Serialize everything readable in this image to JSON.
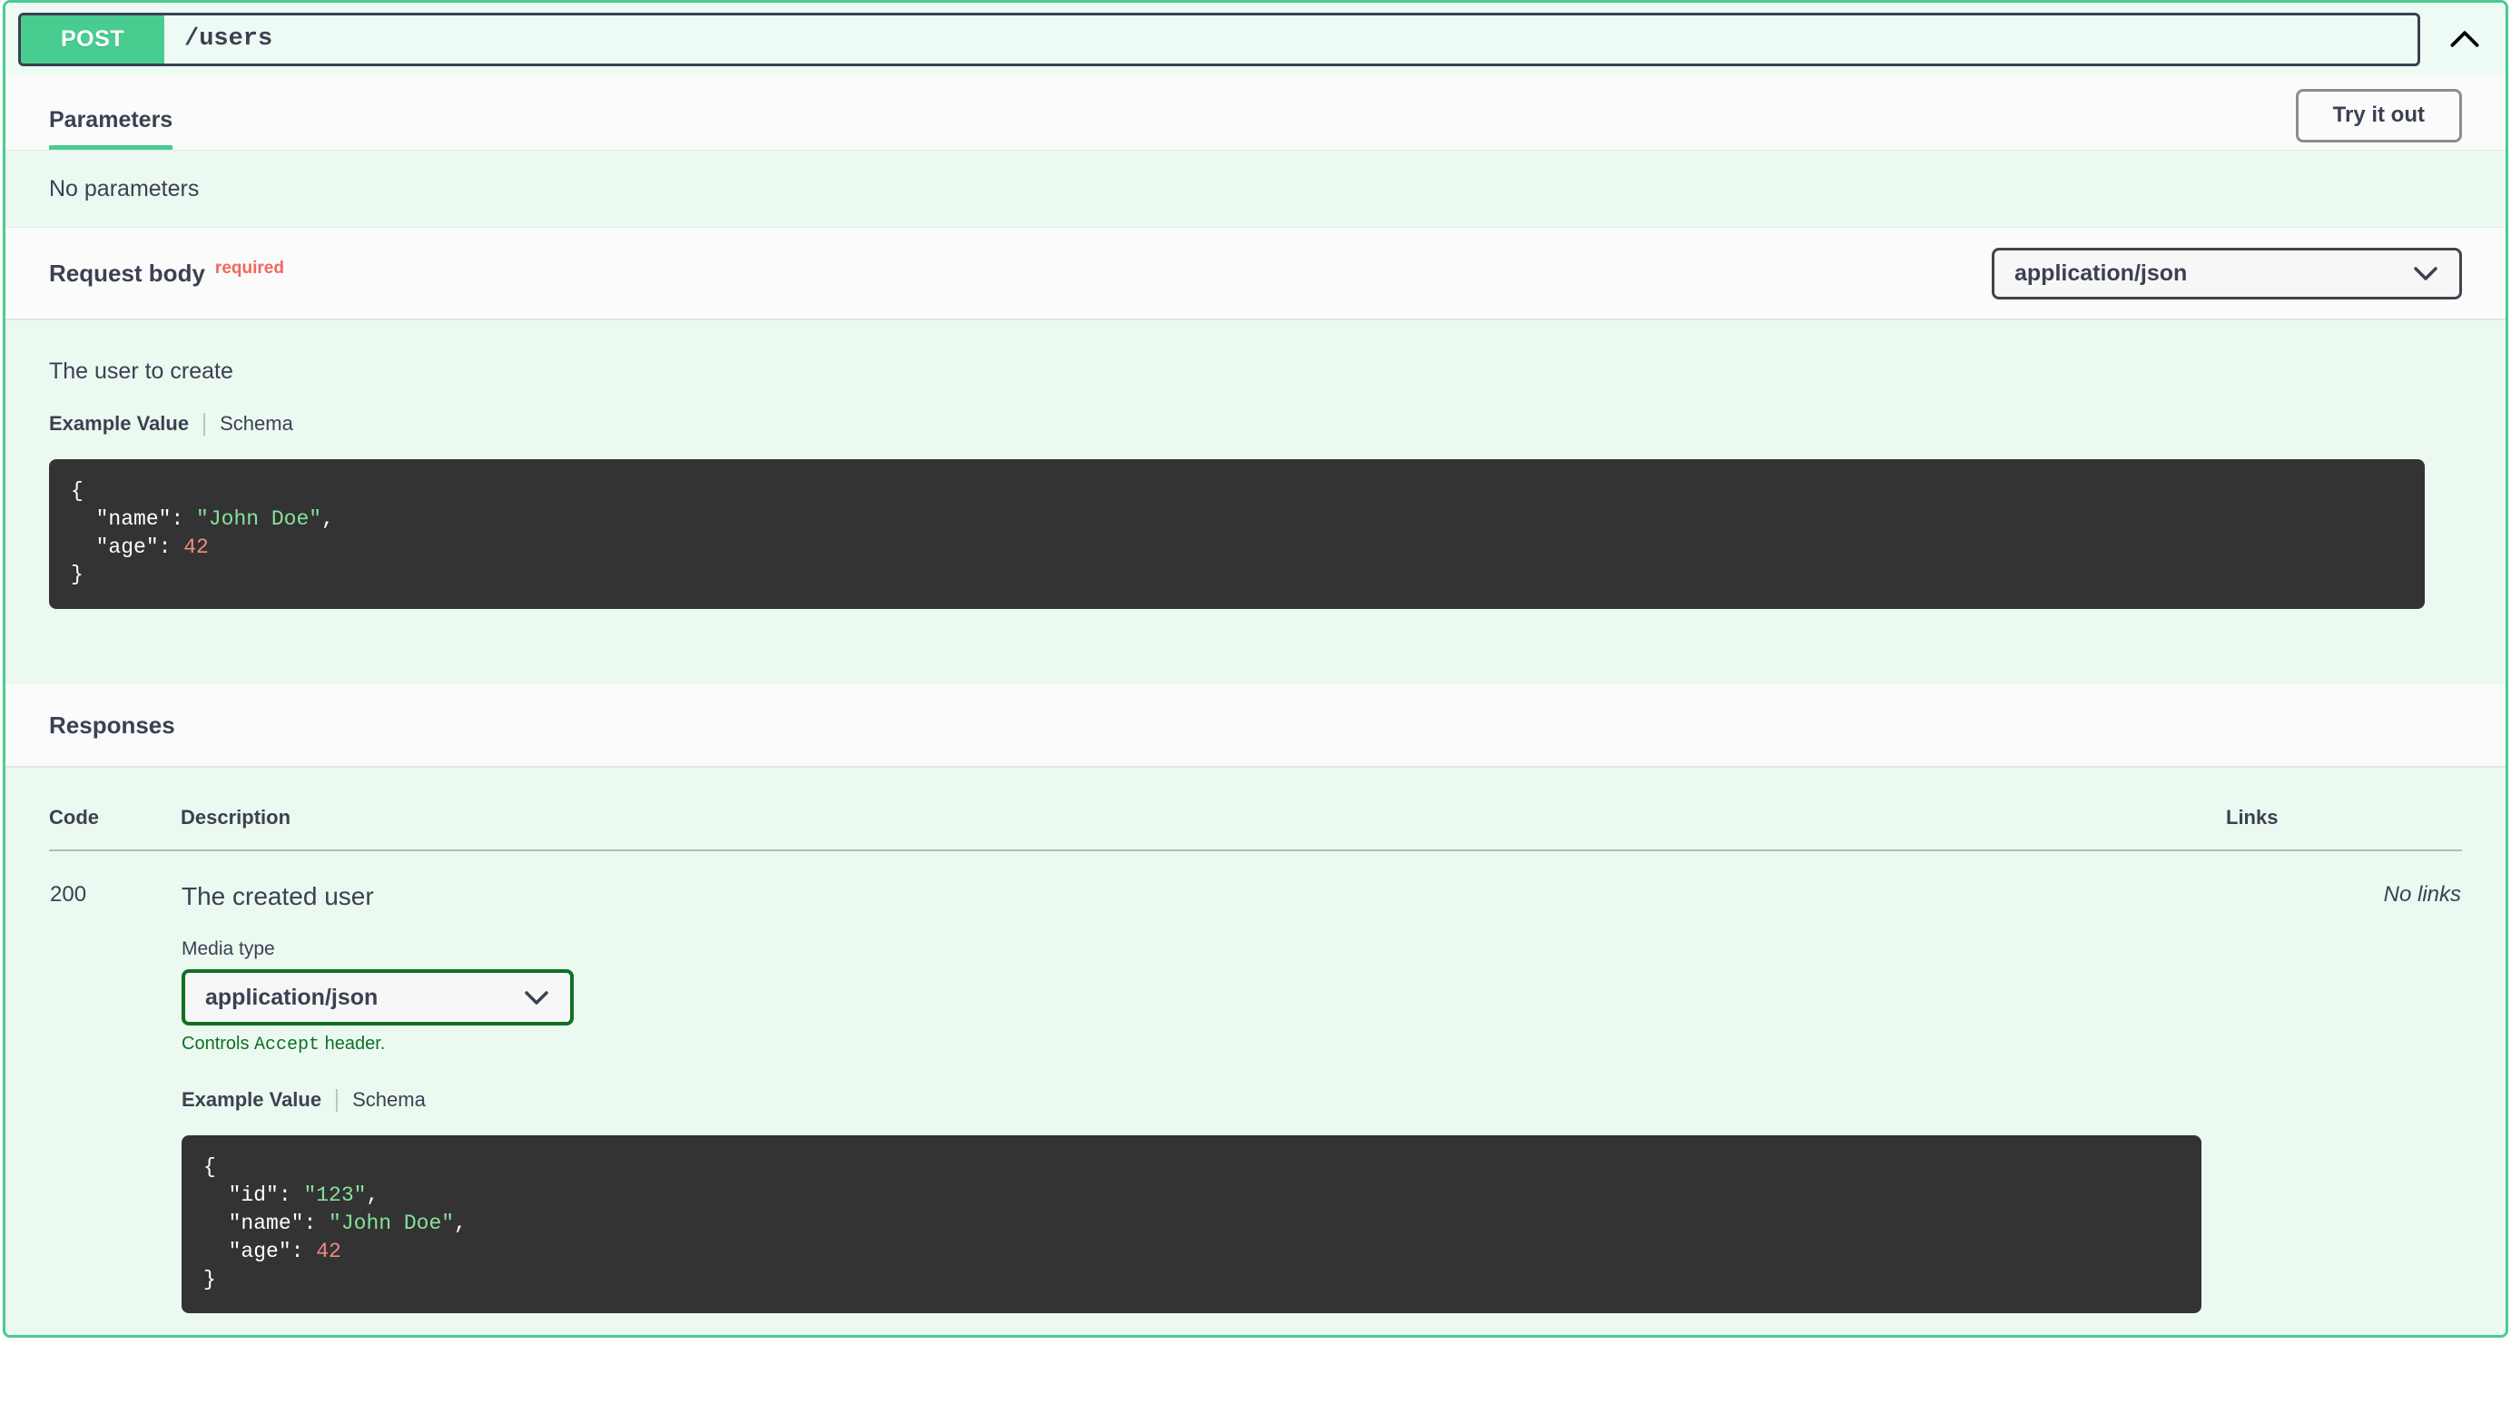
{
  "operation": {
    "method": "POST",
    "path": "/users",
    "collapse_icon": "chevron-up-icon"
  },
  "parameters": {
    "tab_label": "Parameters",
    "try_it_out_label": "Try it out",
    "empty_text": "No parameters"
  },
  "request_body": {
    "title": "Request body",
    "required_label": "required",
    "media_type_value": "application/json",
    "media_type_icon": "chevron-down-icon",
    "description": "The user to create",
    "tab_example_label": "Example Value",
    "tab_schema_label": "Schema",
    "example": {
      "open_brace": "{",
      "lines": [
        {
          "key": "\"name\"",
          "sep": ": ",
          "value": "\"John Doe\"",
          "type": "string",
          "trail": ","
        },
        {
          "key": "\"age\"",
          "sep": ": ",
          "value": "42",
          "type": "number",
          "trail": ""
        }
      ],
      "close_brace": "}"
    }
  },
  "responses": {
    "title": "Responses",
    "columns": {
      "code": "Code",
      "description": "Description",
      "links": "Links"
    },
    "rows": [
      {
        "code": "200",
        "description": "The created user",
        "links": "No links",
        "media_type_label": "Media type",
        "media_type_value": "application/json",
        "media_type_icon": "chevron-down-icon",
        "accept_hint_prefix": "Controls ",
        "accept_hint_mono": "Accept",
        "accept_hint_suffix": " header.",
        "tab_example_label": "Example Value",
        "tab_schema_label": "Schema",
        "example": {
          "open_brace": "{",
          "lines": [
            {
              "key": "\"id\"",
              "sep": ": ",
              "value": "\"123\"",
              "type": "string",
              "trail": ","
            },
            {
              "key": "\"name\"",
              "sep": ": ",
              "value": "\"John Doe\"",
              "type": "string",
              "trail": ","
            },
            {
              "key": "\"age\"",
              "sep": ": ",
              "value": "42",
              "type": "number",
              "trail": ""
            }
          ],
          "close_brace": "}"
        }
      }
    ]
  },
  "colors": {
    "method_green": "#49cc90",
    "panel_border_green": "#49cc90",
    "panel_bg_mint": "#ebf9f1",
    "band_bg": "#fbfbfc",
    "text_dark": "#3b4151",
    "required_red": "#f3665d",
    "code_bg": "#333333",
    "code_string_green": "#86e29b",
    "code_number_red": "#f08d81",
    "accept_green": "#0f7023"
  }
}
